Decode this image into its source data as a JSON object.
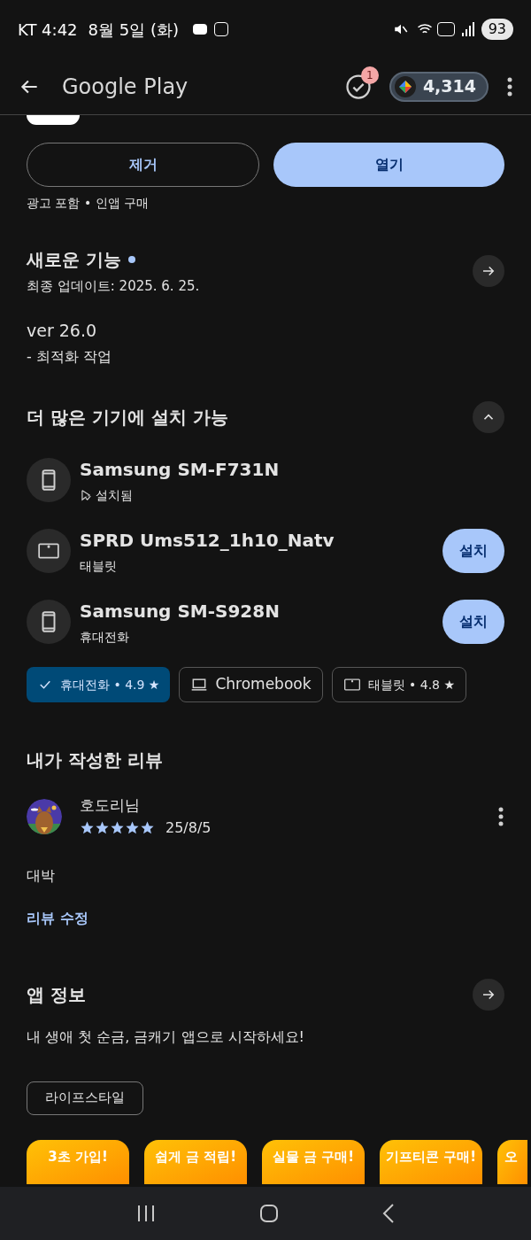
{
  "status_bar": {
    "carrier_time": "KT 4:42",
    "date": "8월 5일 (화)",
    "battery": "93"
  },
  "app_bar": {
    "title": "Google Play",
    "badge": "1",
    "points": "4,314"
  },
  "actions": {
    "uninstall": "제거",
    "open": "열기",
    "notice": "광고 포함 • 인앱 구매"
  },
  "whats_new": {
    "title": "새로운 기능",
    "updated": "최종 업데이트: 2025. 6. 25.",
    "version": "ver 26.0",
    "notes": "- 최적화 작업"
  },
  "devices": {
    "title": "더 많은 기기에 설치 가능",
    "expanded": true,
    "items": [
      {
        "kind": "phone",
        "name": "Samsung SM-F731N",
        "status": "설치됨",
        "installed": true
      },
      {
        "kind": "tablet",
        "name": "SPRD Ums512_1h10_Natv",
        "status": "태블릿",
        "installed": false,
        "button": "설치"
      },
      {
        "kind": "phone",
        "name": "Samsung SM-S928N",
        "status": "휴대전화",
        "installed": false,
        "button": "설치"
      }
    ]
  },
  "filters": [
    {
      "kind": "phone",
      "label": "휴대전화 • 4.9 ★",
      "selected": true
    },
    {
      "kind": "laptop",
      "label": "Chromebook",
      "selected": false
    },
    {
      "kind": "tablet",
      "label": "태블릿 • 4.8 ★",
      "selected": false
    }
  ],
  "my_review": {
    "title": "내가 작성한 리뷰",
    "author": "호도리님",
    "stars": 5,
    "date": "25/8/5",
    "text": "대박",
    "edit": "리뷰 수정"
  },
  "app_info": {
    "title": "앱 정보",
    "description": "내 생애 첫 순금, 금캐기 앱으로 시작하세요!",
    "tag": "라이프스타일"
  },
  "banners": [
    "3초 가입!",
    "쉽게 금 적립!",
    "실물 금 구매!",
    "기프티콘 구매!",
    "오"
  ]
}
